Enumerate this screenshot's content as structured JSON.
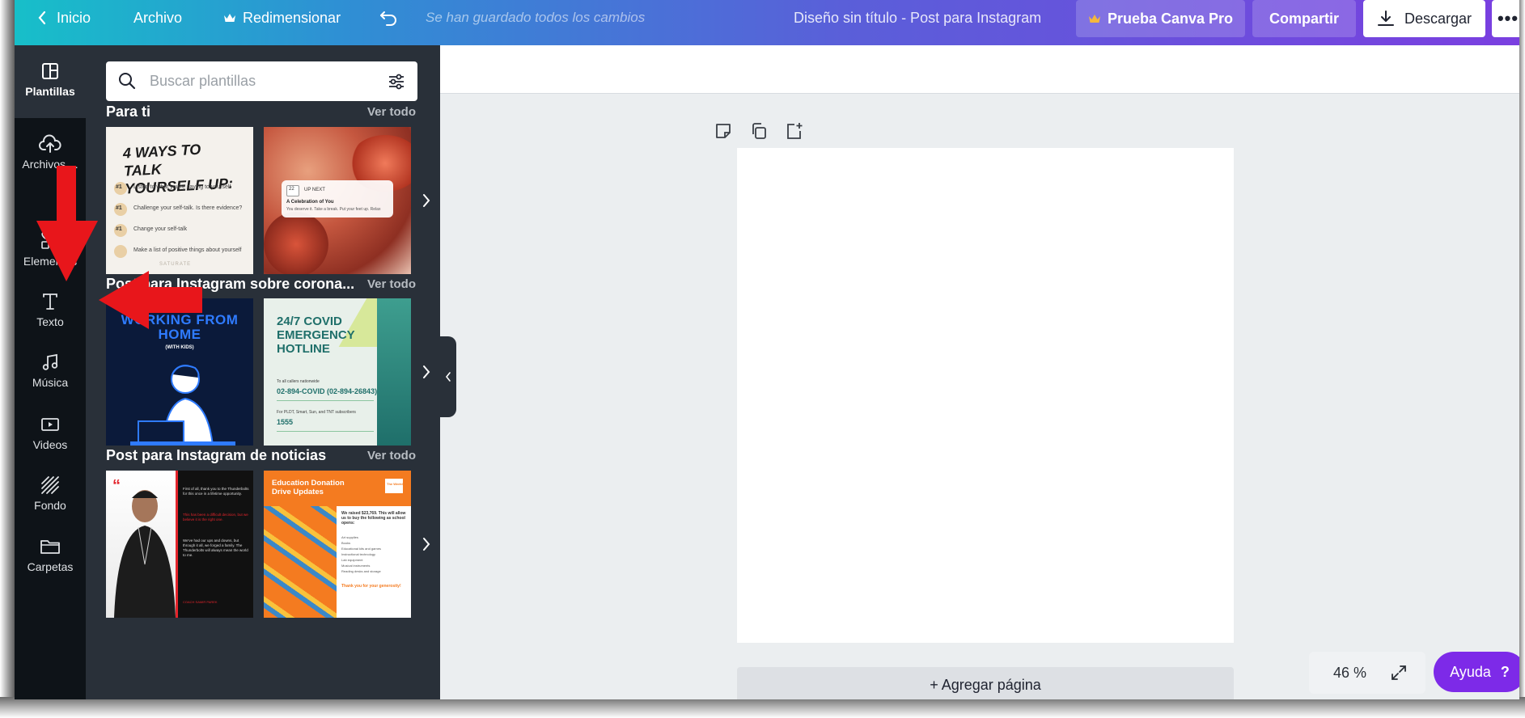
{
  "topbar": {
    "back_label": "Inicio",
    "file_label": "Archivo",
    "resize_label": "Redimensionar",
    "saved_status": "Se han guardado todos los cambios",
    "doc_title": "Diseño sin título - Post para Instagram",
    "pro_label": "Prueba Canva Pro",
    "share_label": "Compartir",
    "download_label": "Descargar",
    "more_label": "•••"
  },
  "rail": {
    "items": [
      {
        "label": "Plantillas",
        "icon": "templates-icon"
      },
      {
        "label": "Archivos ...",
        "icon": "upload-cloud-icon"
      },
      {
        "label": "Elementos",
        "icon": "elements-shapes-icon"
      },
      {
        "label": "Texto",
        "icon": "text-icon"
      },
      {
        "label": "Música",
        "icon": "music-note-icon"
      },
      {
        "label": "Videos",
        "icon": "video-play-icon"
      },
      {
        "label": "Fondo",
        "icon": "background-pattern-icon"
      },
      {
        "label": "Carpetas",
        "icon": "folder-icon"
      }
    ]
  },
  "panel": {
    "search_placeholder": "Buscar plantillas",
    "sections": [
      {
        "title": "Para ti",
        "link": "Ver todo",
        "thumbs": [
          {
            "heading": "4 WAYS TO TALK YOURSELF UP:",
            "lines": [
              "Listen to what you're saying to yourself",
              "Challenge your self-talk. Is there evidence?",
              "Change your self-talk",
              "Make a list of positive things about yourself"
            ],
            "badge": "#1",
            "footer": "SATURATE"
          },
          {
            "date_num": "22",
            "up_next": "UP NEXT",
            "card_title": "A Celebration of You",
            "card_text": "You deserve it. Take a break. Put your feet up. Relax"
          }
        ]
      },
      {
        "title": "Post para Instagram sobre corona...",
        "link": "Ver todo",
        "thumbs": [
          {
            "heading": "WORKING FROM HOME",
            "sub": "(WITH KIDS)"
          },
          {
            "heading": "24/7 COVID EMERGENCY HOTLINE",
            "line1": "To all callers nationwide",
            "phone": "02-894-COVID (02-894-26843)",
            "line2": "For PLDT, Smart, Sun, and TNT subscribers",
            "short": "1555"
          }
        ]
      },
      {
        "title": "Post para Instagram de noticias",
        "link": "Ver todo",
        "thumbs": [
          {
            "quote": "“",
            "p1": "First of all, thank you to the Thunderbolts for this once in a lifetime opportunity.",
            "p2": "This has been a difficult decision, but we believe it is the right one.",
            "p3": "We've had our ups and downs, but through it all, we forged a family. The Thunderbolts will always mean the world to me.",
            "sign": "COACH SAMIR PAREK"
          },
          {
            "heading": "Education Donation Drive Updates",
            "logo": "The Weekly",
            "text": "We raised $23,769. This will allow us to buy the following as school opens:",
            "items": [
              "Art supplies",
              "Books",
              "Educational kits and games",
              "Instructional technology",
              "Lab equipment",
              "Musical instruments",
              "Reading desks and storage"
            ],
            "thanks": "Thank you for your generosity!"
          }
        ]
      }
    ]
  },
  "canvas": {
    "add_page_label": "+ Agregar página",
    "zoom_level": "46 %",
    "help_label": "Ayuda",
    "help_icon": "?"
  },
  "colors": {
    "accent_purple": "#7d2ae8",
    "annotation_red": "#e8161b",
    "panel_bg": "#293039",
    "rail_bg": "#0e1318"
  }
}
